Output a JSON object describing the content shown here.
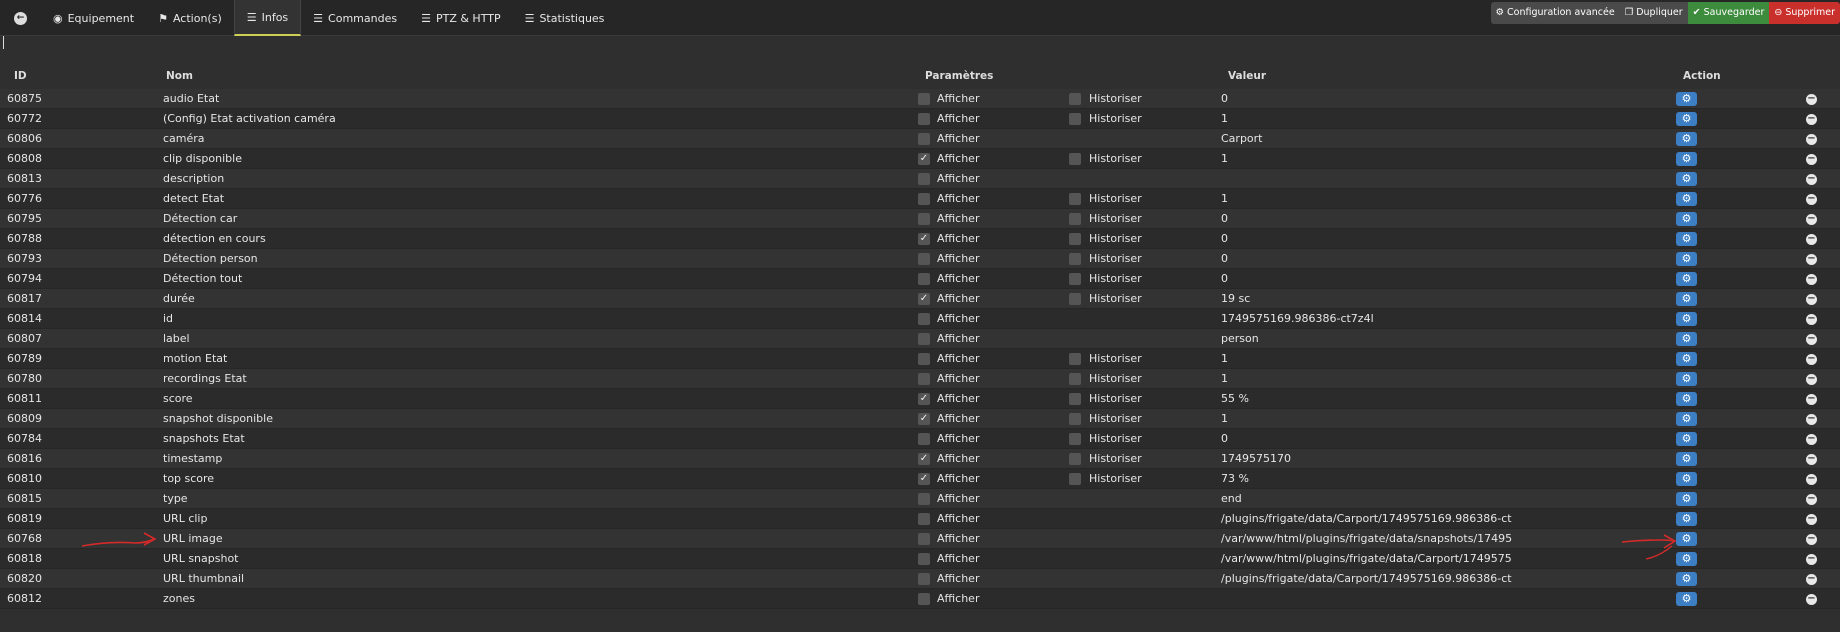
{
  "toolbar": {
    "tabs": [
      {
        "label": "Equipement",
        "icon": "dashboard-icon"
      },
      {
        "label": "Action(s)",
        "icon": "flag-icon"
      },
      {
        "label": "Infos",
        "icon": "list-icon"
      },
      {
        "label": "Commandes",
        "icon": "list-icon"
      },
      {
        "label": "PTZ & HTTP",
        "icon": "list-icon"
      },
      {
        "label": "Statistiques",
        "icon": "list-icon"
      }
    ],
    "buttons": {
      "config": "Configuration avancée",
      "duplicate": "Dupliquer",
      "save": "Sauvegarder",
      "delete": "Supprimer"
    }
  },
  "table": {
    "headers": {
      "id": "ID",
      "nom": "Nom",
      "params": "Paramètres",
      "valeur": "Valeur",
      "action": "Action"
    },
    "afficher_label": "Afficher",
    "historiser_label": "Historiser",
    "rows": [
      {
        "id": "60875",
        "nom": "audio Etat",
        "afficher": false,
        "historiser": false,
        "has_historiser": true,
        "valeur": "0"
      },
      {
        "id": "60772",
        "nom": "(Config) Etat activation caméra",
        "afficher": false,
        "historiser": false,
        "has_historiser": true,
        "valeur": "1"
      },
      {
        "id": "60806",
        "nom": "caméra",
        "afficher": false,
        "historiser": false,
        "has_historiser": false,
        "valeur": "Carport"
      },
      {
        "id": "60808",
        "nom": "clip disponible",
        "afficher": true,
        "historiser": false,
        "has_historiser": true,
        "valeur": "1"
      },
      {
        "id": "60813",
        "nom": "description",
        "afficher": false,
        "historiser": false,
        "has_historiser": false,
        "valeur": ""
      },
      {
        "id": "60776",
        "nom": "detect Etat",
        "afficher": false,
        "historiser": false,
        "has_historiser": true,
        "valeur": "1"
      },
      {
        "id": "60795",
        "nom": "Détection car",
        "afficher": false,
        "historiser": false,
        "has_historiser": true,
        "valeur": "0"
      },
      {
        "id": "60788",
        "nom": "détection en cours",
        "afficher": true,
        "historiser": false,
        "has_historiser": true,
        "valeur": "0"
      },
      {
        "id": "60793",
        "nom": "Détection person",
        "afficher": false,
        "historiser": false,
        "has_historiser": true,
        "valeur": "0"
      },
      {
        "id": "60794",
        "nom": "Détection tout",
        "afficher": false,
        "historiser": false,
        "has_historiser": true,
        "valeur": "0"
      },
      {
        "id": "60817",
        "nom": "durée",
        "afficher": true,
        "historiser": false,
        "has_historiser": true,
        "valeur": "19 sc"
      },
      {
        "id": "60814",
        "nom": "id",
        "afficher": false,
        "historiser": false,
        "has_historiser": false,
        "valeur": "1749575169.986386-ct7z4l"
      },
      {
        "id": "60807",
        "nom": "label",
        "afficher": false,
        "historiser": false,
        "has_historiser": false,
        "valeur": "person"
      },
      {
        "id": "60789",
        "nom": "motion Etat",
        "afficher": false,
        "historiser": false,
        "has_historiser": true,
        "valeur": "1"
      },
      {
        "id": "60780",
        "nom": "recordings Etat",
        "afficher": false,
        "historiser": false,
        "has_historiser": true,
        "valeur": "1"
      },
      {
        "id": "60811",
        "nom": "score",
        "afficher": true,
        "historiser": false,
        "has_historiser": true,
        "valeur": "55 %"
      },
      {
        "id": "60809",
        "nom": "snapshot disponible",
        "afficher": true,
        "historiser": false,
        "has_historiser": true,
        "valeur": "1"
      },
      {
        "id": "60784",
        "nom": "snapshots Etat",
        "afficher": false,
        "historiser": false,
        "has_historiser": true,
        "valeur": "0"
      },
      {
        "id": "60816",
        "nom": "timestamp",
        "afficher": true,
        "historiser": false,
        "has_historiser": true,
        "valeur": "1749575170"
      },
      {
        "id": "60810",
        "nom": "top score",
        "afficher": true,
        "historiser": false,
        "has_historiser": true,
        "valeur": "73 %"
      },
      {
        "id": "60815",
        "nom": "type",
        "afficher": false,
        "historiser": false,
        "has_historiser": false,
        "valeur": "end"
      },
      {
        "id": "60819",
        "nom": "URL clip",
        "afficher": false,
        "historiser": false,
        "has_historiser": false,
        "valeur": "/plugins/frigate/data/Carport/1749575169.986386-ct"
      },
      {
        "id": "60768",
        "nom": "URL image",
        "afficher": false,
        "historiser": false,
        "has_historiser": false,
        "valeur": "/var/www/html/plugins/frigate/data/snapshots/17495"
      },
      {
        "id": "60818",
        "nom": "URL snapshot",
        "afficher": false,
        "historiser": false,
        "has_historiser": false,
        "valeur": "/var/www/html/plugins/frigate/data/Carport/1749575"
      },
      {
        "id": "60820",
        "nom": "URL thumbnail",
        "afficher": false,
        "historiser": false,
        "has_historiser": false,
        "valeur": "/plugins/frigate/data/Carport/1749575169.986386-ct"
      },
      {
        "id": "60812",
        "nom": "zones",
        "afficher": false,
        "historiser": false,
        "has_historiser": false,
        "valeur": ""
      }
    ]
  },
  "annotations": {
    "arrow_color": "#d42a2a"
  }
}
